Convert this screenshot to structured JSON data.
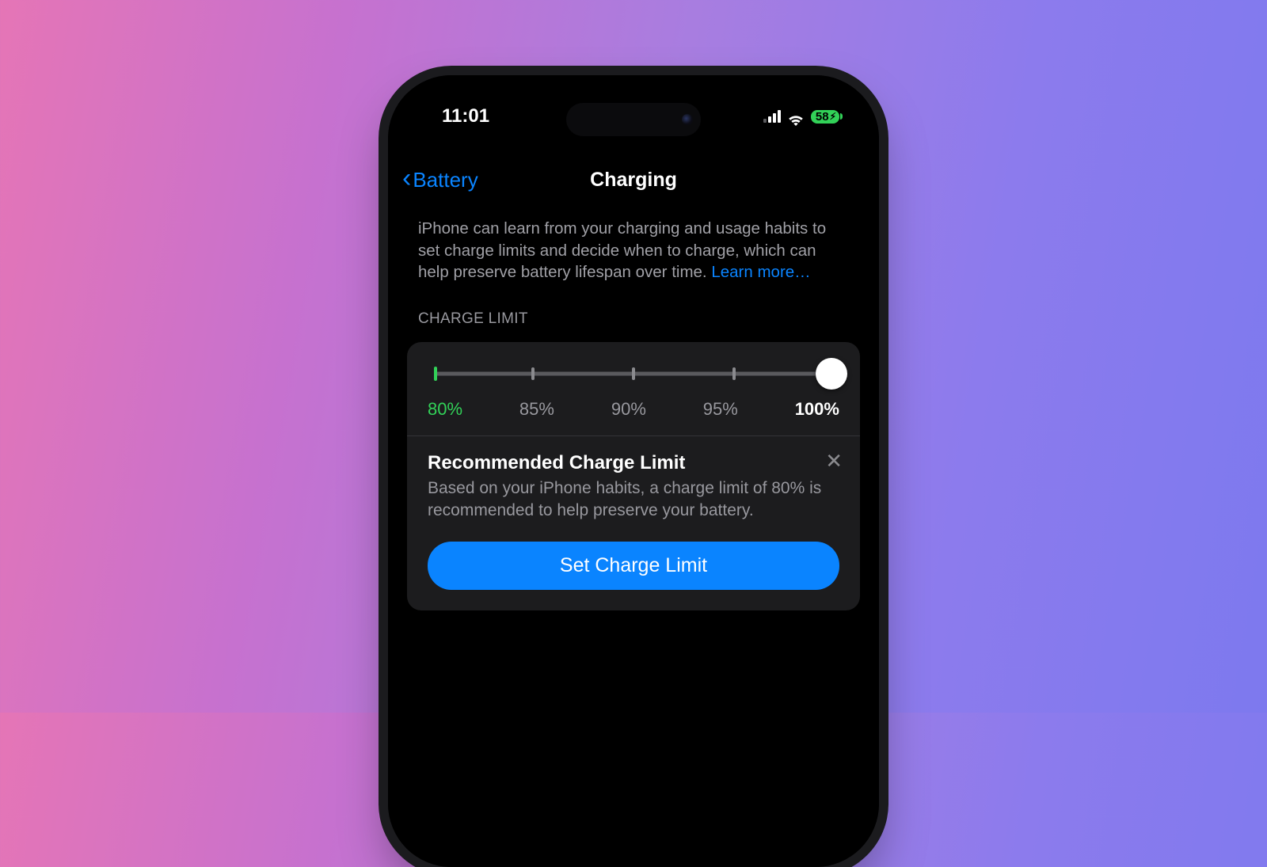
{
  "status": {
    "time": "11:01",
    "battery_pct": "58",
    "signal_bars_filled": 3
  },
  "nav": {
    "back_label": "Battery",
    "title": "Charging"
  },
  "intro": {
    "text": "iPhone can learn from your charging and usage habits to set charge limits and decide when to charge, which can help preserve battery lifespan over time.",
    "link": "Learn more…"
  },
  "section_header": "CHARGE LIMIT",
  "slider": {
    "steps": [
      "80%",
      "85%",
      "90%",
      "95%",
      "100%"
    ],
    "selected_index": 4,
    "recommended_index": 0
  },
  "recommendation": {
    "title": "Recommended Charge Limit",
    "body": "Based on your iPhone habits, a charge limit of 80% is recommended to help preserve your battery.",
    "button": "Set Charge Limit",
    "close": "✕"
  }
}
